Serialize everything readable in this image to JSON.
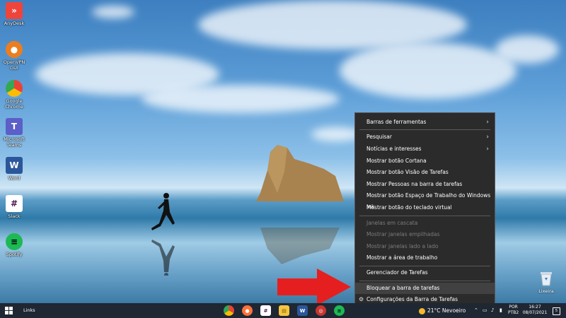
{
  "desktop_icons": [
    {
      "label": "AnyDesk",
      "glyph": "»",
      "color": "#ef443b"
    },
    {
      "label": "OpenVPN GUI",
      "glyph": "●",
      "color": "#ea7e20"
    },
    {
      "label": "Google Chrome",
      "glyph": "◉",
      "color": "#4285f4"
    },
    {
      "label": "Microsoft Teams",
      "glyph": "T",
      "color": "#5b5fc7"
    },
    {
      "label": "Word",
      "glyph": "W",
      "color": "#2b579a"
    },
    {
      "label": "Slack",
      "glyph": "#",
      "color": "#4a154b"
    },
    {
      "label": "Spotify",
      "glyph": "≡",
      "color": "#1db954"
    }
  ],
  "recycle_bin": {
    "label": "Lixeira"
  },
  "context_menu": {
    "items": [
      {
        "label": "Barras de ferramentas",
        "submenu": true
      },
      {
        "label": "Pesquisar",
        "submenu": true
      },
      {
        "label": "Notícias e interesses",
        "submenu": true
      },
      {
        "label": "Mostrar botão Cortana"
      },
      {
        "label": "Mostrar botão Visão de Tarefas"
      },
      {
        "label": "Mostrar Pessoas na barra de tarefas"
      },
      {
        "label": "Mostrar botão Espaço de Trabalho do Windows Ink"
      },
      {
        "label": "Mostrar botão do teclado virtual"
      },
      {
        "label": "Janelas em cascata",
        "disabled": true
      },
      {
        "label": "Mostrar janelas empilhadas",
        "disabled": true
      },
      {
        "label": "Mostrar janelas lado a lado",
        "disabled": true
      },
      {
        "label": "Mostrar a área de trabalho"
      },
      {
        "label": "Gerenciador de Tarefas"
      },
      {
        "label": "Bloquear a barra de tarefas",
        "highlighted": true
      },
      {
        "label": "Configurações da Barra de Tarefas",
        "icon": "gear-icon"
      }
    ]
  },
  "taskbar": {
    "links_label": "Links",
    "weather": {
      "temp": "21°C",
      "condition": "Nevoeiro"
    },
    "language": {
      "line1": "POR",
      "line2": "PTB2"
    },
    "clock": {
      "time": "16:27",
      "date": "08/07/2021"
    },
    "notification_count": "5",
    "apps": [
      {
        "name": "chrome-taskbar-icon",
        "glyph": "◉",
        "color": "#4285f4"
      },
      {
        "name": "firefox-taskbar-icon",
        "glyph": "●",
        "color": "#ff7139"
      },
      {
        "name": "slack-taskbar-icon",
        "glyph": "#",
        "color": "#4a154b"
      },
      {
        "name": "file-explorer-taskbar-icon",
        "glyph": "▤",
        "color": "#f4c542"
      },
      {
        "name": "word-taskbar-icon",
        "glyph": "W",
        "color": "#2b579a"
      },
      {
        "name": "app-taskbar-icon",
        "glyph": "◎",
        "color": "#c8362f"
      },
      {
        "name": "spotify-taskbar-icon",
        "glyph": "≡",
        "color": "#1db954"
      }
    ]
  }
}
